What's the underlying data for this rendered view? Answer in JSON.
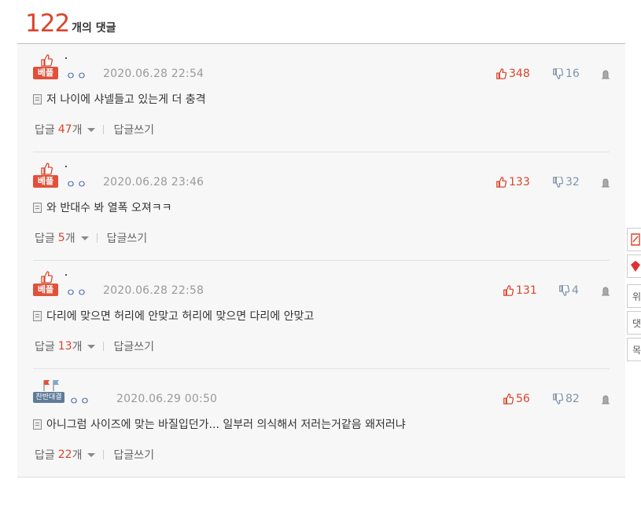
{
  "header": {
    "count": "122",
    "suffix": "개의 댓글"
  },
  "comments": [
    {
      "badge": "베플",
      "nick": "ㅇㅇ",
      "date": "2020.06.28 22:54",
      "up": "348",
      "down": "16",
      "text": "저 나이에 샤넬들고 있는게 더 충격",
      "reply_label": "답글",
      "reply_count": "47",
      "reply_unit": "개",
      "write_label": "답글쓰기"
    },
    {
      "badge": "베플",
      "nick": "ㅇㅇ",
      "date": "2020.06.28 23:46",
      "up": "133",
      "down": "32",
      "text": "와 반대수 봐 열폭 오져ㅋㅋ",
      "reply_label": "답글",
      "reply_count": "5",
      "reply_unit": "개",
      "write_label": "답글쓰기"
    },
    {
      "badge": "베플",
      "nick": "ㅇㅇ",
      "date": "2020.06.28 22:58",
      "up": "131",
      "down": "4",
      "text": "다리에 맞으면 허리에 안맞고 허리에 맞으면 다리에 안맞고",
      "reply_label": "답글",
      "reply_count": "13",
      "reply_unit": "개",
      "write_label": "답글쓰기"
    },
    {
      "badge": "찬반대결",
      "nick": "ㅇㅇ",
      "date": "2020.06.29 00:50",
      "up": "56",
      "down": "82",
      "text": "아니그럼 사이즈에 맞는 바질입던가... 일부러 의식해서 저러는거같음 왜저러냐",
      "reply_label": "답글",
      "reply_count": "22",
      "reply_unit": "개",
      "write_label": "답글쓰기"
    }
  ],
  "side": {
    "item3": "위",
    "item4": "댓",
    "item5": "목"
  },
  "colors": {
    "accent": "#d9452c",
    "down": "#7f93ab",
    "badge_best": "#e2503a",
    "badge_vs": "#5f7b99"
  }
}
